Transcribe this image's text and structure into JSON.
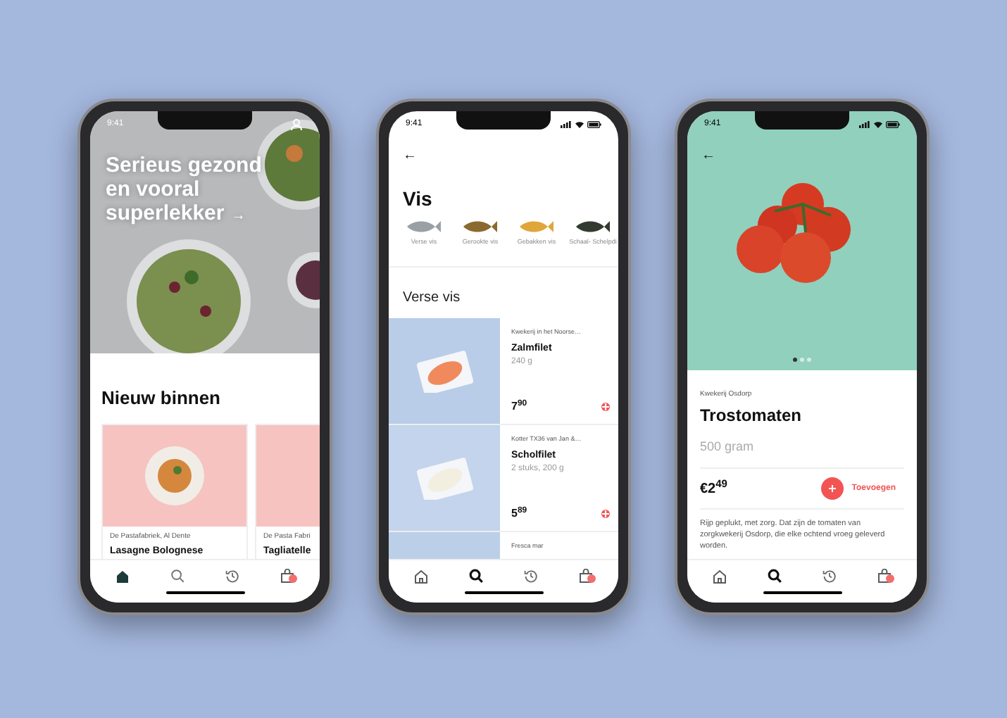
{
  "phones": [
    {
      "kind": "home",
      "status_time": "9:41",
      "headline": "Serieus gezond en vooral superlekker",
      "headline_arrow": "→",
      "section_title": "Nieuw binnen",
      "cards": [
        {
          "supplier": "De Pastafabriek, Al Dente",
          "name": "Lasagne Bolognese"
        },
        {
          "supplier": "De Pasta Fabri",
          "name": "Tagliatelle"
        }
      ],
      "tabs": [
        {
          "kind": "home",
          "selected": true
        },
        {
          "kind": "search",
          "selected": false
        },
        {
          "kind": "history",
          "selected": false
        },
        {
          "kind": "bag",
          "selected": false
        }
      ]
    },
    {
      "kind": "category",
      "status_time": "9:41",
      "back": "←",
      "title": "Vis",
      "categories": [
        {
          "label": "Verse vis"
        },
        {
          "label": "Gerookte vis"
        },
        {
          "label": "Gebakken vis"
        },
        {
          "label": "Schaal- Schelpdi"
        }
      ],
      "section_title": "Verse vis",
      "products": [
        {
          "supplier": "Kwekerij in het Noorse…",
          "name": "Zalmfilet",
          "amount": "240 g",
          "price": "7$^{90}$"
        },
        {
          "supplier": "Kotter TX36 van Jan &…",
          "name": "Scholfilet",
          "amount": "2 stuks, 200 g",
          "price": "5$^{89}$"
        },
        {
          "supplier": "Fresca mar"
        }
      ],
      "tabs": [
        {
          "kind": "home",
          "selected": false
        },
        {
          "kind": "search",
          "selected": true
        },
        {
          "kind": "history",
          "selected": false
        },
        {
          "kind": "bag",
          "selected": false
        }
      ]
    },
    {
      "kind": "product",
      "status_time": "9:41",
      "back": "←",
      "pager": [
        {
          "selected": true
        },
        {
          "selected": false
        },
        {
          "selected": false
        }
      ],
      "supplier": "Kwekerij Osdorp",
      "name": "Trostomaten",
      "amount": "500 gram",
      "price": "€2$^{49}$",
      "add_label": "Toevoegen",
      "description": "Rijp geplukt, met zorg. Dat zijn de tomaten van zorgkwekerij Osdorp, die elke ochtend vroeg geleverd worden.",
      "tabs": [
        {
          "kind": "home",
          "selected": false
        },
        {
          "kind": "search",
          "selected": true
        },
        {
          "kind": "history",
          "selected": false
        },
        {
          "kind": "bag",
          "selected": false
        }
      ]
    }
  ]
}
